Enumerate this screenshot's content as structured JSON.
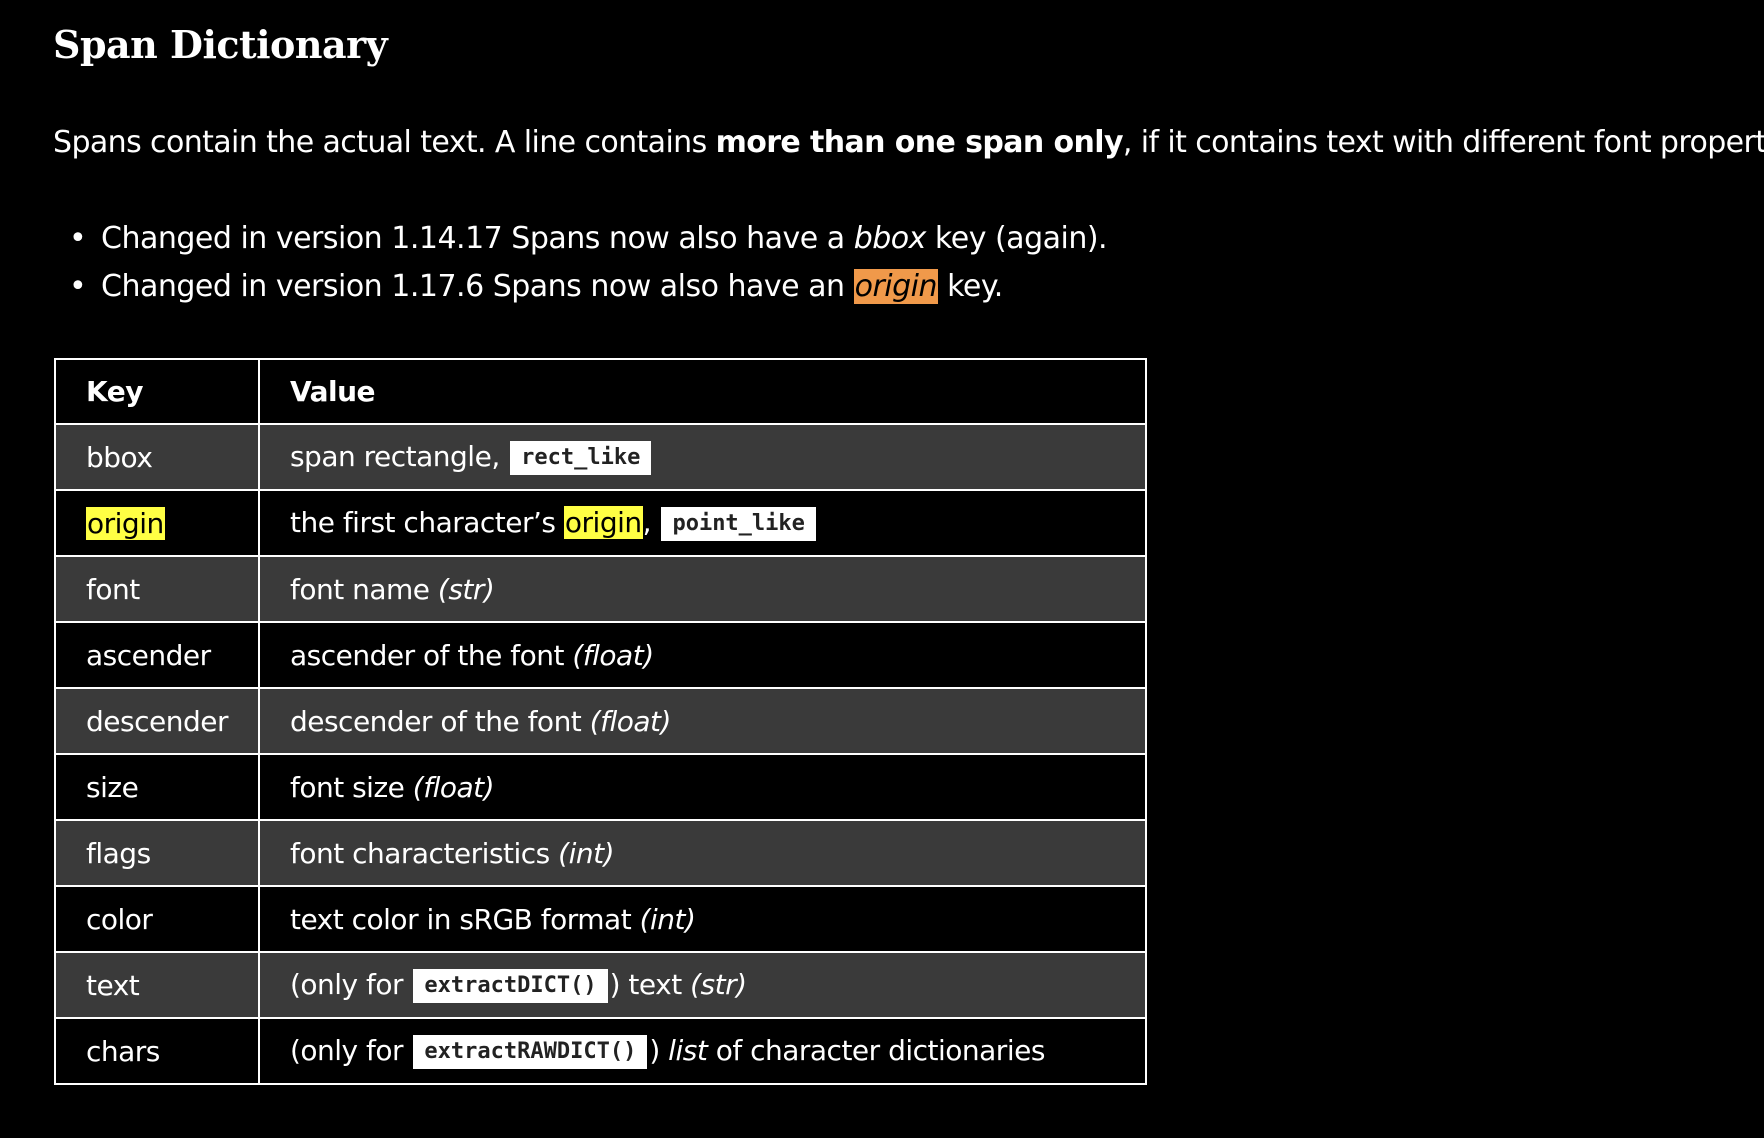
{
  "title": "Span Dictionary",
  "intro": {
    "before": "Spans contain the actual text. A line contains ",
    "bold": "more than one span only",
    "after": ", if it contains text with different font properties."
  },
  "changes": [
    {
      "bullet": "•",
      "before": "Changed in version 1.14.17 Spans now also have a ",
      "em": "bbox",
      "after": " key (again)."
    },
    {
      "bullet": "•",
      "before": "Changed in version 1.17.6 Spans now also have an ",
      "highlight": "origin",
      "after": " key."
    }
  ],
  "table": {
    "headers": [
      "Key",
      "Value"
    ],
    "rows": [
      {
        "key": "bbox",
        "text": "span rectangle, ",
        "code": "rect_like"
      },
      {
        "key": "origin",
        "text": "the first character’s ",
        "highlight": "origin",
        "sep": ",",
        "code": "point_like"
      },
      {
        "key": "font",
        "text": "font name ",
        "type": "(str)"
      },
      {
        "key": "ascender",
        "text": "ascender of the font ",
        "type": "(float)"
      },
      {
        "key": "descender",
        "text": "descender of the font ",
        "type": "(float)"
      },
      {
        "key": "size",
        "text": "font size ",
        "type": "(float)"
      },
      {
        "key": "flags",
        "text": "font characteristics ",
        "type": "(int)"
      },
      {
        "key": "color",
        "text": "text color in sRGB format ",
        "type": "(int)"
      },
      {
        "key": "text",
        "prefix": "(only for ",
        "code": "extractDICT()",
        "suffix": ") text ",
        "type": "(str)"
      },
      {
        "key": "chars",
        "prefix": "(only for ",
        "code": "extractRAWDICT()",
        "suffix": ") ",
        "em": "list",
        "after": " of character dictionaries"
      }
    ]
  },
  "colors": {
    "background": "#000000",
    "row_alt": "#3a3a3a",
    "highlight_orange": "#f0994a",
    "highlight_yellow": "#ffff44",
    "code_bg": "#ffffff"
  }
}
